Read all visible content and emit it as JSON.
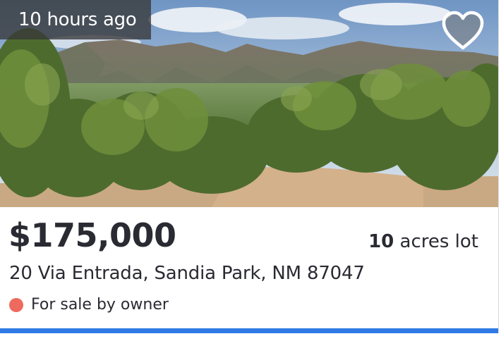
{
  "listing": {
    "time_ago": "10 hours ago",
    "price": "$175,000",
    "lot_size_value": "10",
    "lot_size_label": "acres lot",
    "address": "20 Via Entrada, Sandia Park, NM 87047",
    "status_text": "For sale by owner"
  },
  "icons": {
    "favorite": "heart-icon",
    "status": "status-dot"
  },
  "colors": {
    "status_dot": "#ee6a5f",
    "accent_bar": "#2f7ae5",
    "badge_bg": "#373737",
    "text": "#2a2a33"
  }
}
